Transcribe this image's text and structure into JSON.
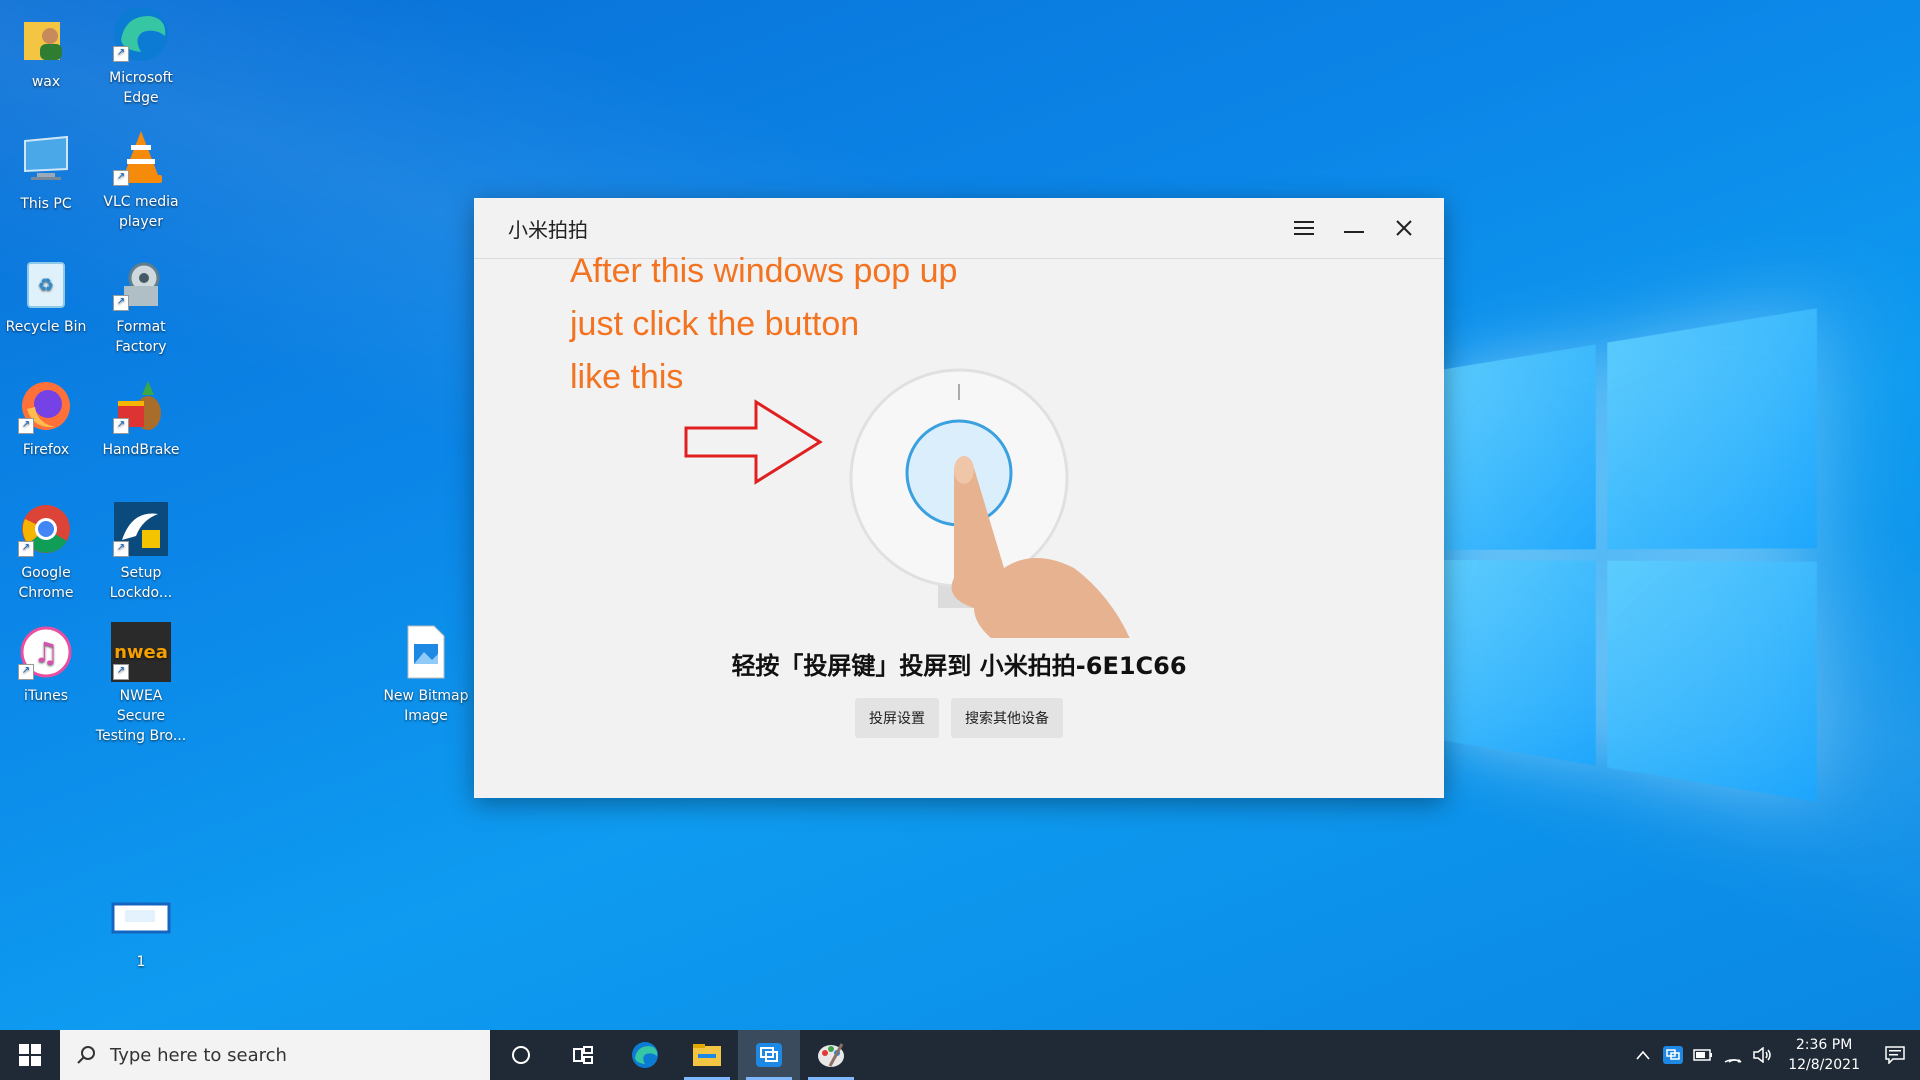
{
  "desktop": {
    "icons": [
      {
        "label": "wax"
      },
      {
        "label": "Microsoft Edge"
      },
      {
        "label": "This PC"
      },
      {
        "label": "VLC media player"
      },
      {
        "label": "Recycle Bin"
      },
      {
        "label": "Format Factory"
      },
      {
        "label": "Firefox"
      },
      {
        "label": "HandBrake"
      },
      {
        "label": "Google Chrome"
      },
      {
        "label": "Setup Lockdo..."
      },
      {
        "label": "iTunes"
      },
      {
        "label": "NWEA Secure Testing Bro..."
      },
      {
        "label": "New Bitmap Image"
      },
      {
        "label": "1"
      }
    ],
    "nwea_logo_text": "nwea"
  },
  "window": {
    "title": "小米拍拍",
    "annotation": {
      "line1": "After this windows pop up",
      "line2": "just click the button",
      "line3": "like this"
    },
    "instruction": "轻按「投屏键」投屏到 小米拍拍-6E1C66",
    "buttons": {
      "settings": "投屏设置",
      "search_devices": "搜索其他设备"
    }
  },
  "taskbar": {
    "search_placeholder": "Type here to search",
    "time": "2:36 PM",
    "date": "12/8/2021"
  },
  "colors": {
    "annotation": "#f37321",
    "arrow": "#e02020",
    "taskbar": "#1f2a36"
  }
}
